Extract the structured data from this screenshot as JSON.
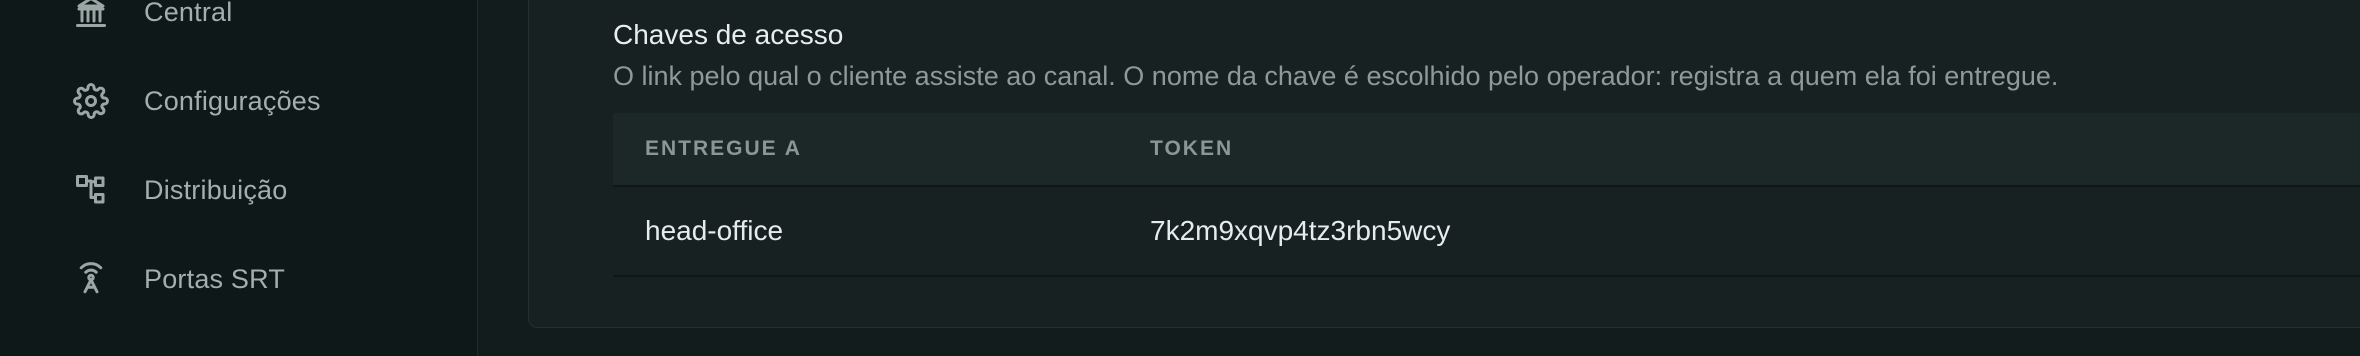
{
  "sidebar": {
    "items": [
      {
        "label": "Central",
        "icon": "bank-icon"
      },
      {
        "label": "Configurações",
        "icon": "gear-icon"
      },
      {
        "label": "Distribuição",
        "icon": "distribution-icon"
      },
      {
        "label": "Portas SRT",
        "icon": "broadcast-icon"
      }
    ]
  },
  "access_keys": {
    "title": "Chaves de acesso",
    "description": "O link pelo qual o cliente assiste ao canal. O nome da chave é escolhido pelo operador: registra a quem ela foi entregue.",
    "columns": [
      "ENTREGUE A",
      "TOKEN"
    ],
    "rows": [
      {
        "delivered_to": "head-office",
        "token": "7k2m9xqvp4tz3rbn5wcy"
      }
    ]
  },
  "colors": {
    "sidebar_bg": "#0e1818",
    "main_bg": "#131c1c",
    "card_bg": "#172121",
    "text_primary": "#e8eeed",
    "text_muted": "#8e9a98"
  }
}
